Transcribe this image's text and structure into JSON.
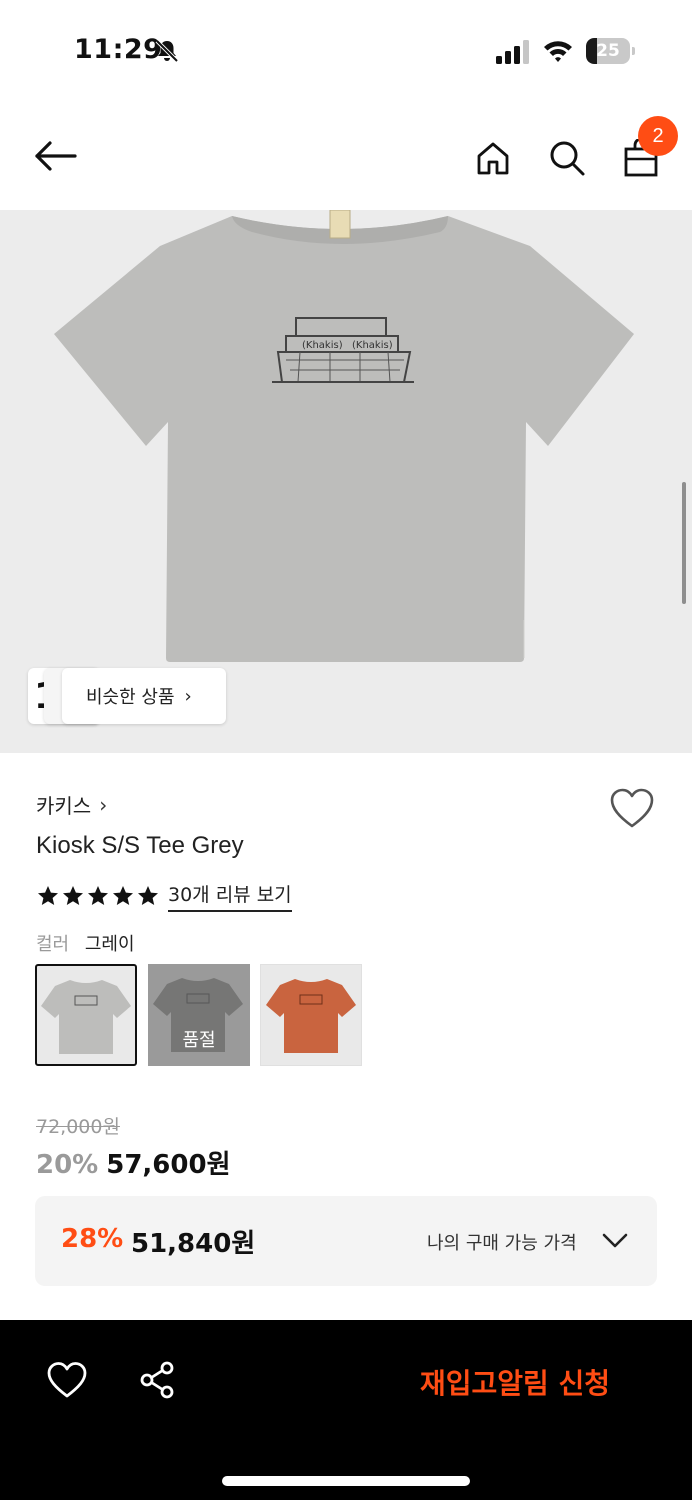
{
  "status_bar": {
    "time": "11:29",
    "battery_level": "25",
    "battery_fraction": 0.25
  },
  "nav": {
    "cart_count": "2",
    "icons": [
      "back-arrow-icon",
      "home-icon",
      "search-icon",
      "shopping-bag-icon"
    ]
  },
  "hero": {
    "similar_button": "비슷한 상품",
    "similar_chevron": "›",
    "stack_peek": "1"
  },
  "product": {
    "brand": "카키스",
    "brand_chevron": "›",
    "title": "Kiosk S/S Tee Grey",
    "rating_stars": 5,
    "review_link": "30개 리뷰 보기",
    "color_label": "컬러",
    "color_value": "그레이",
    "swatches": [
      {
        "color": "#bdbdbb",
        "selected": true
      },
      {
        "color": "#9a9a98",
        "sold_out_label": "품절"
      },
      {
        "color": "#c9643f"
      }
    ],
    "original_price": "72,000원",
    "discount": "20%",
    "price": "57,600원"
  },
  "my_price": {
    "discount": "28%",
    "price": "51,840원",
    "label": "나의 구매 가능 가격"
  },
  "bottom_bar": {
    "restock_button": "재입고알림 신청"
  },
  "colors": {
    "accent": "#ff4d14",
    "shirt_grey": "#bdbdbb",
    "shirt_orange": "#c9643f"
  }
}
